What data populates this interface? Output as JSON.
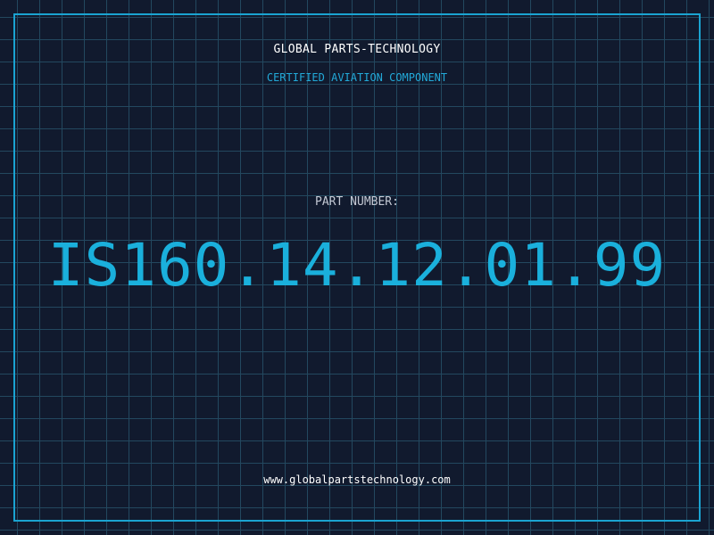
{
  "header": {
    "company_name": "GLOBAL PARTS-TECHNOLOGY",
    "subtitle": "CERTIFIED AVIATION COMPONENT"
  },
  "part": {
    "label": "PART NUMBER:",
    "number": "IS160.14.12.01.99"
  },
  "footer": {
    "website": "www.globalpartstechnology.com"
  },
  "colors": {
    "background": "#111a2e",
    "grid": "#23485f",
    "accent": "#1ab0dc",
    "text": "#ffffff"
  }
}
